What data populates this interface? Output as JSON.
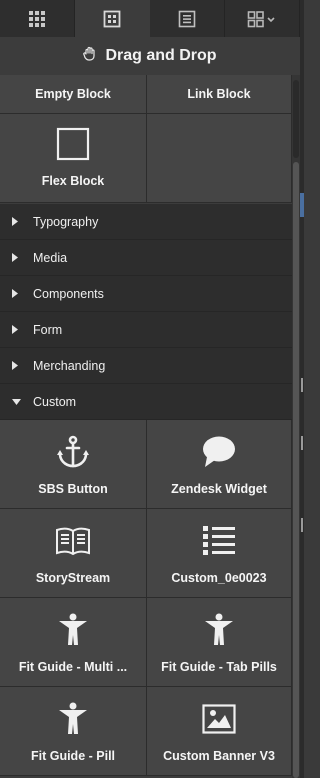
{
  "tabs": [
    {
      "name": "grid-apps-icon",
      "active": false
    },
    {
      "name": "blocks-icon",
      "active": true
    },
    {
      "name": "document-icon",
      "active": false
    },
    {
      "name": "layout-dropdown-icon",
      "active": false
    }
  ],
  "header": {
    "title": "Drag and Drop",
    "icon": "hand-drag-icon"
  },
  "top_blocks": [
    {
      "label": "Empty Block",
      "icon": ""
    },
    {
      "label": "Link Block",
      "icon": ""
    },
    {
      "label": "Flex Block",
      "icon": "square-outline-icon"
    },
    {
      "label": "",
      "icon": ""
    }
  ],
  "categories": [
    {
      "label": "Typography",
      "expanded": false
    },
    {
      "label": "Media",
      "expanded": false
    },
    {
      "label": "Components",
      "expanded": false
    },
    {
      "label": "Form",
      "expanded": false
    },
    {
      "label": "Merchanding",
      "expanded": false
    },
    {
      "label": "Custom",
      "expanded": true
    }
  ],
  "custom_blocks": [
    {
      "label": "SBS Button",
      "icon": "anchor-icon"
    },
    {
      "label": "Zendesk Widget",
      "icon": "speech-bubble-icon"
    },
    {
      "label": "StoryStream",
      "icon": "open-book-icon"
    },
    {
      "label": "Custom_0e0023",
      "icon": "list-icon"
    },
    {
      "label": "Fit Guide - Multi ...",
      "icon": "person-icon"
    },
    {
      "label": "Fit Guide - Tab Pills",
      "icon": "person-icon"
    },
    {
      "label": "Fit Guide - Pill",
      "icon": "person-icon"
    },
    {
      "label": "Custom Banner V3",
      "icon": "image-icon"
    }
  ],
  "colors": {
    "panel": "#3c3c3c",
    "cell": "#454545",
    "category": "#2d2d2d",
    "text": "#f5f5f5"
  }
}
